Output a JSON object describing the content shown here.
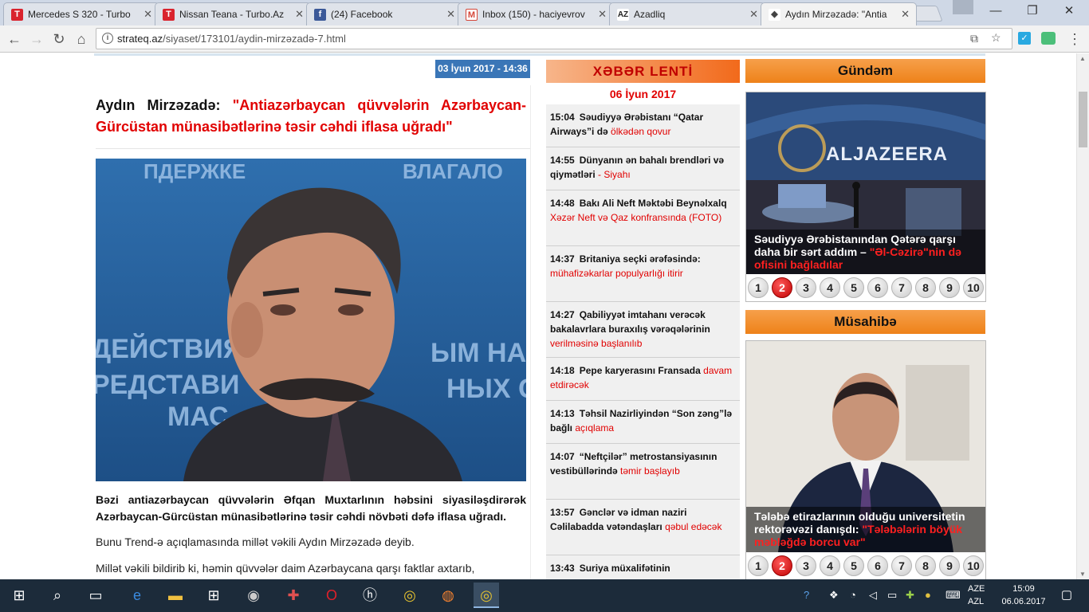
{
  "browser": {
    "tabs": [
      {
        "title": "Mercedes S 320 - Turbo",
        "favicon": "T",
        "favicon_color": "#d9232d"
      },
      {
        "title": "Nissan Teana - Turbo.Az",
        "favicon": "T",
        "favicon_color": "#d9232d"
      },
      {
        "title": "(24) Facebook",
        "favicon": "f",
        "favicon_color": "#3b5998"
      },
      {
        "title": "Inbox (150) - haciyevrov",
        "favicon": "M",
        "favicon_color": "#d44638"
      },
      {
        "title": "Azadliq",
        "favicon": "AZ",
        "favicon_color": "#222222"
      },
      {
        "title": "Aydın Mirzəzadə: \"Antia",
        "favicon": "",
        "favicon_color": "#444444"
      }
    ],
    "url_host": "strateq.az",
    "url_path": "/siyaset/173101/aydin-mirzəzadə-7.html"
  },
  "article": {
    "date": "03 İyun 2017 - 14:36",
    "author": "Aydın Mirzəzadə:",
    "quote": "\"Antiazərbaycan qüvvələrin Azərbaycan-Gürcüstan münasibətlərinə təsir cəhdi iflasa uğradı\"",
    "photo_text": [
      "ПДЕРЖКЕ",
      "ВЛАГАЛО",
      "ДЕЙСТВИЯ",
      "РЕДСТАВИ",
      "МАС",
      "ЫМ НА",
      "НЫХ С"
    ],
    "lead": "Bəzi antiazərbaycan qüvvələrin Əfqan Muxtarlının həbsini siyasiləşdirərək Azərbaycan-Gürcüstan münasibətlərinə təsir cəhdi növbəti dəfə iflasa uğradı.",
    "paragraphs": [
      "Bunu Trend-ə açıqlamasında millət vəkili Aydın Mirzəzadə deyib.",
      "Millət vəkili bildirib ki, həmin qüvvələr daim Azərbaycana qarşı faktlar axtarıb,"
    ]
  },
  "feed": {
    "title": "XƏBƏR LENTİ",
    "date": "06 İyun 2017",
    "items": [
      {
        "time": "15:04",
        "black": "Səudiyyə Ərəbistanı “Qatar Airways”i də",
        "red": "ölkədən qovur"
      },
      {
        "time": "14:55",
        "black": "Dünyanın ən bahalı brendləri və qiymətləri",
        "red": "- Siyahı"
      },
      {
        "time": "14:48",
        "black": "Bakı Ali Neft Məktəbi Beynəlxalq",
        "red": "Xəzər Neft və Qaz konfransında (FOTO)"
      },
      {
        "time": "14:37",
        "black": "Britaniya seçki ərəfəsində:",
        "red": "mühafizəkarlar populyarlığı itirir"
      },
      {
        "time": "14:27",
        "black": "Qabiliyyət imtahanı verəcək bakalavrlara buraxılış vərəqələrinin",
        "red": "verilməsinə başlanılıb"
      },
      {
        "time": "14:18",
        "black": "Pepe karyerasını Fransada",
        "red": "davam etdirəcək"
      },
      {
        "time": "14:13",
        "black": "Təhsil Nazirliyindən “Son zəng”lə bağlı",
        "red": "açıqlama"
      },
      {
        "time": "14:07",
        "black": "“Neftçilər” metrostansiyasının vestibüllərində",
        "red": "təmir başlayıb"
      },
      {
        "time": "13:57",
        "black": "Gənclər və idman naziri Cəlilabadda vətəndaşları",
        "red": "qəbul edəcək"
      },
      {
        "time": "13:43",
        "black": "Suriya müxalifətinin",
        "red": ""
      }
    ]
  },
  "gundem": {
    "title": "Gündəm",
    "image_text": "ALJAZEERA",
    "caption_black": "Səudiyyə Ərəbistanından Qətərə qarşı daha bir sərt addım –",
    "caption_red": "\"Əl-Cəzirə\"nin də ofisini bağladılar",
    "pages": [
      "1",
      "2",
      "3",
      "4",
      "5",
      "6",
      "7",
      "8",
      "9",
      "10"
    ],
    "selected_page": 2
  },
  "musahibe": {
    "title": "Müsahibə",
    "caption_black": "Tələbə etirazlarının olduğu universitetin rektorəvəzi danışdı:",
    "caption_red": "\"Tələbələrin böyük məbləğdə borcu var\"",
    "pages": [
      "1",
      "2",
      "3",
      "4",
      "5",
      "6",
      "7",
      "8",
      "9",
      "10"
    ],
    "selected_page": 2
  },
  "taskbar": {
    "lang_top": "AZE",
    "lang_bottom": "AZL",
    "time": "15:09",
    "date": "06.06.2017"
  }
}
